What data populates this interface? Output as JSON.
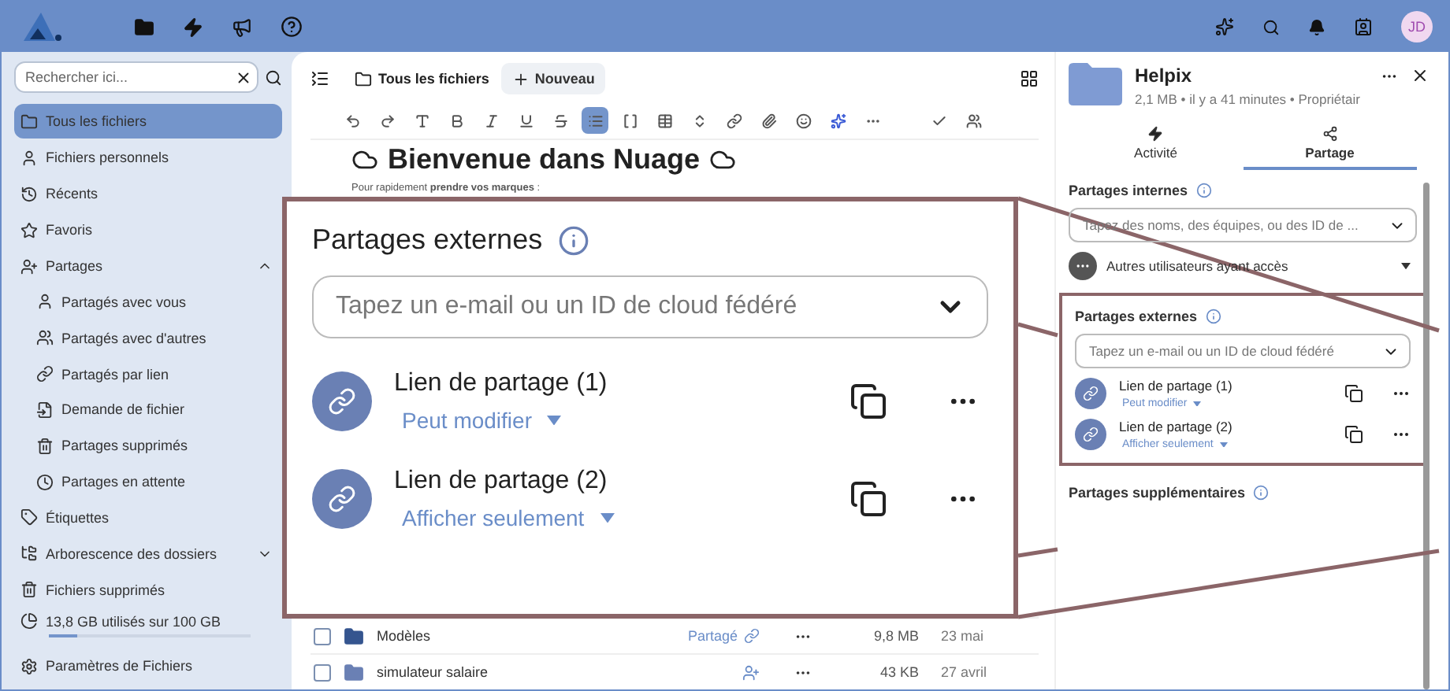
{
  "top_bar": {
    "avatar": "JD"
  },
  "sidebar": {
    "search": {
      "placeholder": "Rechercher ici..."
    },
    "items": [
      {
        "kind": "all-files",
        "label": "Tous les fichiers",
        "selected": true
      },
      {
        "kind": "personal",
        "label": "Fichiers personnels",
        "selected": false
      },
      {
        "kind": "recent",
        "label": "Récents",
        "selected": false
      },
      {
        "kind": "favorites",
        "label": "Favoris",
        "selected": false
      },
      {
        "kind": "shares",
        "label": "Partages",
        "selected": false,
        "expanded": true,
        "children": [
          {
            "kind": "shared-with-you",
            "label": "Partagés avec vous",
            "selected": false
          },
          {
            "kind": "shared-with-others",
            "label": "Partagés avec d'autres",
            "selected": false
          },
          {
            "kind": "shared-by-link",
            "label": "Partagés par lien",
            "selected": false
          },
          {
            "kind": "file-request",
            "label": "Demande de fichier",
            "selected": false
          },
          {
            "kind": "deleted-shares",
            "label": "Partages supprimés",
            "selected": false
          },
          {
            "kind": "pending-shares",
            "label": "Partages en attente",
            "selected": false
          }
        ]
      },
      {
        "kind": "tags",
        "label": "Étiquettes",
        "selected": false
      },
      {
        "kind": "folder-tree",
        "label": "Arborescence des dossiers",
        "selected": false,
        "expanded": false
      },
      {
        "kind": "deleted-files",
        "label": "Fichiers supprimés",
        "selected": false
      }
    ],
    "storage": {
      "text": "13,8 GB utilisés sur 100 GB",
      "level": 0.14
    },
    "settings": "Paramètres de Fichiers"
  },
  "main": {
    "breadcrumb": "Tous les fichiers",
    "new_button": "Nouveau",
    "toolbar": [
      {
        "kind": "undo",
        "selected": false
      },
      {
        "kind": "redo",
        "selected": false
      },
      {
        "kind": "heading",
        "selected": false
      },
      {
        "kind": "bold",
        "selected": false
      },
      {
        "kind": "italic",
        "selected": false
      },
      {
        "kind": "underline",
        "selected": false
      },
      {
        "kind": "strike",
        "selected": false
      },
      {
        "kind": "list",
        "selected": true
      },
      {
        "kind": "code",
        "selected": false
      },
      {
        "kind": "table",
        "selected": false
      },
      {
        "kind": "expand",
        "selected": false
      },
      {
        "kind": "link",
        "selected": false
      },
      {
        "kind": "attach",
        "selected": false
      },
      {
        "kind": "emoji",
        "selected": false
      },
      {
        "kind": "ai",
        "selected": false
      },
      {
        "kind": "more",
        "selected": false
      },
      {
        "kind": "done",
        "selected": false
      },
      {
        "kind": "people",
        "selected": false
      }
    ],
    "document": {
      "title": "Bienvenue dans Nuage",
      "intro": "Pour rapidement **prendre vos marques** :"
    },
    "files": [
      {
        "kind": "shared-folder",
        "name": "Modèles",
        "share_label": "Partagé",
        "shared": true,
        "checked": false,
        "size": "9,8 MB",
        "date": "23 mai"
      },
      {
        "kind": "folder",
        "name": "simulateur salaire",
        "shared": false,
        "checked": false,
        "size": "43 KB",
        "date": "27 avril"
      }
    ]
  },
  "details": {
    "title": "Helpix",
    "meta": "2,1 MB • il y a 41 minutes • Propriétair",
    "tabs": [
      {
        "kind": "activity",
        "label": "Activité",
        "selected": false
      },
      {
        "kind": "sharing",
        "label": "Partage",
        "selected": true
      }
    ],
    "internal": {
      "heading": "Partages internes",
      "placeholder": "Tapez des noms, des équipes, ou des ID de ...",
      "others": "Autres utilisateurs ayant accès"
    },
    "external": {
      "heading": "Partages externes",
      "placeholder": "Tapez un e-mail ou un ID de cloud fédéré",
      "links": [
        {
          "name": "Lien de partage (1)",
          "permission": "Peut modifier"
        },
        {
          "name": "Lien de partage (2)",
          "permission": "Afficher seulement"
        }
      ]
    },
    "additional": {
      "heading": "Partages supplémentaires"
    }
  },
  "callout": {
    "heading": "Partages externes",
    "placeholder": "Tapez un e-mail ou un ID de cloud fédéré",
    "links": [
      {
        "name": "Lien de partage (1)",
        "permission": "Peut modifier"
      },
      {
        "name": "Lien de partage (2)",
        "permission": "Afficher seulement"
      }
    ]
  }
}
